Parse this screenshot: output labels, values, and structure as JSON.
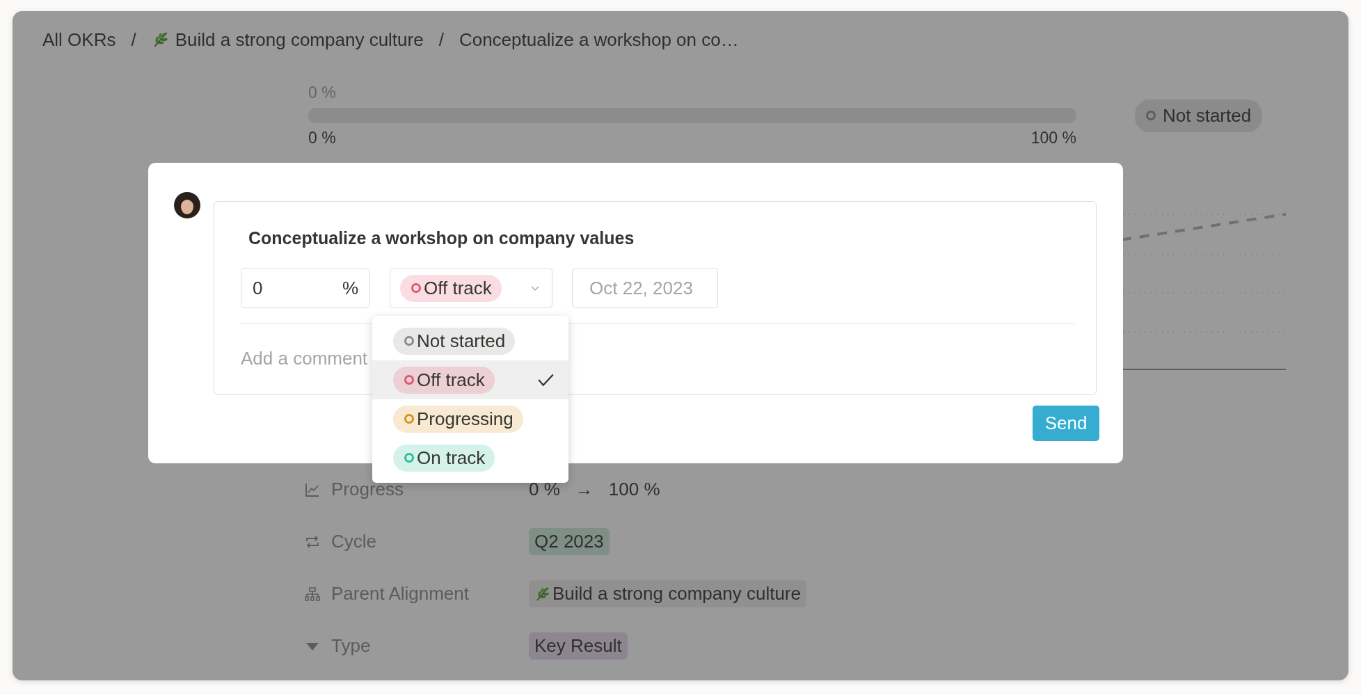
{
  "breadcrumb": {
    "separator": "/",
    "items": [
      {
        "label": "All OKRs",
        "kind": "plain"
      },
      {
        "label": "Build a strong company culture",
        "kind": "objective"
      },
      {
        "label": "Conceptualize a workshop on co…",
        "kind": "plain"
      }
    ]
  },
  "progress": {
    "current": "0 %",
    "level": 0,
    "min": "0 %",
    "max": "100 %"
  },
  "status_badge": {
    "label": "Not started",
    "color": "#8a8a8a"
  },
  "properties": [
    {
      "kind": "progress",
      "label": "Progress",
      "from": "0 %",
      "arrow": "→",
      "to": "100 %"
    },
    {
      "kind": "cycle",
      "label": "Cycle",
      "value": "Q2 2023"
    },
    {
      "kind": "alignment",
      "label": "Parent Alignment",
      "value": "Build a strong company culture"
    },
    {
      "kind": "type",
      "label": "Type",
      "value": "Key Result"
    }
  ],
  "modal": {
    "title": "Conceptualize a workshop on company values",
    "percent": {
      "value": "0",
      "unit": "%"
    },
    "status": {
      "label": "Off track",
      "color": "#e2566f"
    },
    "date": {
      "placeholder": "Oct 22, 2023"
    },
    "comment": {
      "placeholder": "Add a comment"
    },
    "send": "Send",
    "options": [
      {
        "label": "Not started",
        "color": "#8a8a8a",
        "selected": false
      },
      {
        "label": "Off track",
        "color": "#e2566f",
        "selected": true
      },
      {
        "label": "Progressing",
        "color": "#d9911d",
        "selected": false
      },
      {
        "label": "On track",
        "color": "#2bbf94",
        "selected": false
      }
    ]
  }
}
